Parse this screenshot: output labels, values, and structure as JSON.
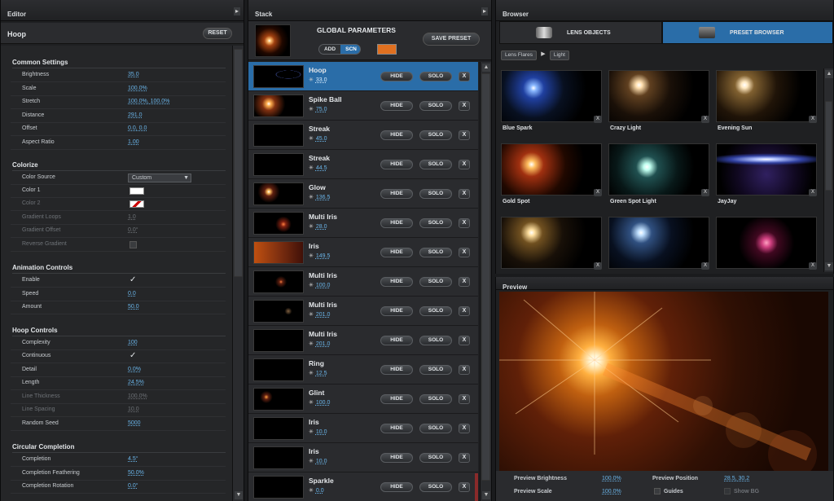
{
  "editor": {
    "panel_title": "Editor",
    "effect_name": "Hoop",
    "reset_label": "RESET",
    "sections": {
      "common": "Common Settings",
      "colorize": "Colorize",
      "animation": "Animation Controls",
      "hoop": "Hoop Controls",
      "circular": "Circular Completion"
    },
    "common": [
      {
        "label": "Brightness",
        "value": "35.0"
      },
      {
        "label": "Scale",
        "value": "100.0%"
      },
      {
        "label": "Stretch",
        "value": "100.0%, 100.0%"
      },
      {
        "label": "Distance",
        "value": "291.0"
      },
      {
        "label": "Offset",
        "value": "0.0, 0.0"
      },
      {
        "label": "Aspect Ratio",
        "value": "1.00"
      }
    ],
    "colorize": {
      "color_source_label": "Color Source",
      "color_source_value": "Custom",
      "color1_label": "Color 1",
      "color1_hex": "#ffffff",
      "color2_label": "Color 2",
      "gradient_loops_label": "Gradient Loops",
      "gradient_loops_value": "1.0",
      "gradient_offset_label": "Gradient Offset",
      "gradient_offset_value": "0.0°",
      "reverse_gradient_label": "Reverse Gradient"
    },
    "animation": {
      "enable_label": "Enable",
      "speed_label": "Speed",
      "speed_value": "0.0",
      "amount_label": "Amount",
      "amount_value": "50.0"
    },
    "hoop": {
      "complexity_label": "Complexity",
      "complexity_value": "100",
      "continuous_label": "Continuous",
      "detail_label": "Detail",
      "detail_value": "0.0%",
      "length_label": "Length",
      "length_value": "24.5%",
      "line_thickness_label": "Line Thickness",
      "line_thickness_value": "100.0%",
      "line_spacing_label": "Line Spacing",
      "line_spacing_value": "10.0",
      "random_seed_label": "Random Seed",
      "random_seed_value": "5000"
    },
    "circular": {
      "completion_label": "Completion",
      "completion_value": "4.5°",
      "feathering_label": "Completion Feathering",
      "feathering_value": "50.0%",
      "rotation_label": "Completion Rotation",
      "rotation_value": "0.0°"
    }
  },
  "stack": {
    "panel_title": "Stack",
    "global_label": "GLOBAL PARAMETERS",
    "add_label": "ADD",
    "scn_label": "SCN",
    "save_preset_label": "SAVE PRESET",
    "global_color": "#e07020",
    "hide_label": "HIDE",
    "solo_label": "SOLO",
    "x_label": "X",
    "items": [
      {
        "name": "Hoop",
        "value": "33.0"
      },
      {
        "name": "Spike Ball",
        "value": "75.0"
      },
      {
        "name": "Streak",
        "value": "45.0"
      },
      {
        "name": "Streak",
        "value": "44.5"
      },
      {
        "name": "Glow",
        "value": "136.5"
      },
      {
        "name": "Multi Iris",
        "value": "28.0"
      },
      {
        "name": "Iris",
        "value": "149.5"
      },
      {
        "name": "Multi Iris",
        "value": "100.0"
      },
      {
        "name": "Multi Iris",
        "value": "201.0"
      },
      {
        "name": "Multi Iris",
        "value": "201.0"
      },
      {
        "name": "Ring",
        "value": "12.5"
      },
      {
        "name": "Glint",
        "value": "100.0"
      },
      {
        "name": "Iris",
        "value": "10.0"
      },
      {
        "name": "Iris",
        "value": "10.0"
      },
      {
        "name": "Sparkle",
        "value": "0.0"
      }
    ]
  },
  "browser": {
    "panel_title": "Browser",
    "tab_lens": "LENS OBJECTS",
    "tab_preset": "PRESET BROWSER",
    "crumb1": "Lens Flares",
    "crumb2": "Light",
    "x_label": "X",
    "presets": [
      "Blue Spark",
      "Crazy Light",
      "Evening Sun",
      "Gold Spot",
      "Green Spot Light",
      "JayJay",
      "",
      "",
      ""
    ]
  },
  "preview": {
    "panel_title": "Preview",
    "brightness_label": "Preview Brightness",
    "brightness_value": "100.0%",
    "scale_label": "Preview Scale",
    "scale_value": "100.0%",
    "position_label": "Preview Position",
    "position_value": "28.5, 30.2",
    "guides_label": "Guides",
    "showbg_label": "Show BG"
  },
  "colors": {
    "accent": "#2a6da8",
    "link": "#6ab4e8"
  }
}
